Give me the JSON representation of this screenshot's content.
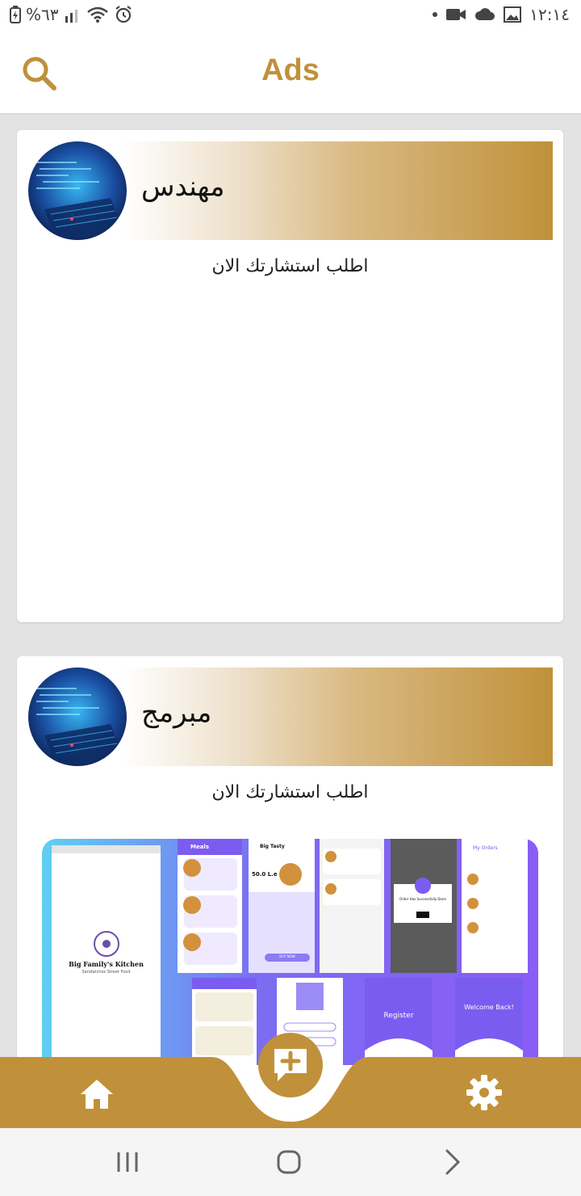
{
  "status_bar": {
    "battery_text": "%٦٣",
    "time": "١٢:١٤",
    "left_icons": [
      "battery-charging-icon",
      "signal-icon",
      "wifi-icon",
      "alarm-icon"
    ],
    "right_icons": [
      "notification-dot-icon",
      "video-icon",
      "cloud-icon",
      "image-icon"
    ]
  },
  "app_bar": {
    "title": "Ads",
    "search_icon": "search-icon"
  },
  "ads": [
    {
      "title": "مهندس",
      "subtitle": "اطلب استشارتك الان",
      "avatar": "laptop-code-image"
    },
    {
      "title": "مبرمج",
      "subtitle": "اطلب استشارتك الان",
      "avatar": "laptop-code-image",
      "image_texts": {
        "splash_title": "Big Family's Kitchen",
        "splash_subtitle": "Sandwiches Street Food",
        "meals_header": "Meals",
        "price": "50.0 L.e",
        "product_title": "Big Tasty",
        "my_orders": "My Orders",
        "register": "Register",
        "welcome_back": "Welcome Back!",
        "order_done": "Order Has Successfully Done",
        "buy_now": "BUY NOW"
      }
    }
  ],
  "bottom_nav": {
    "home_icon": "home-icon",
    "add_icon": "add-message-icon",
    "settings_icon": "gear-icon"
  },
  "system_nav": {
    "recents_icon": "recents-icon",
    "home_icon": "circle-home-icon",
    "back_icon": "back-chevron-icon"
  },
  "colors": {
    "accent": "#c0913a",
    "background": "#e3e3e3",
    "card": "#ffffff"
  }
}
